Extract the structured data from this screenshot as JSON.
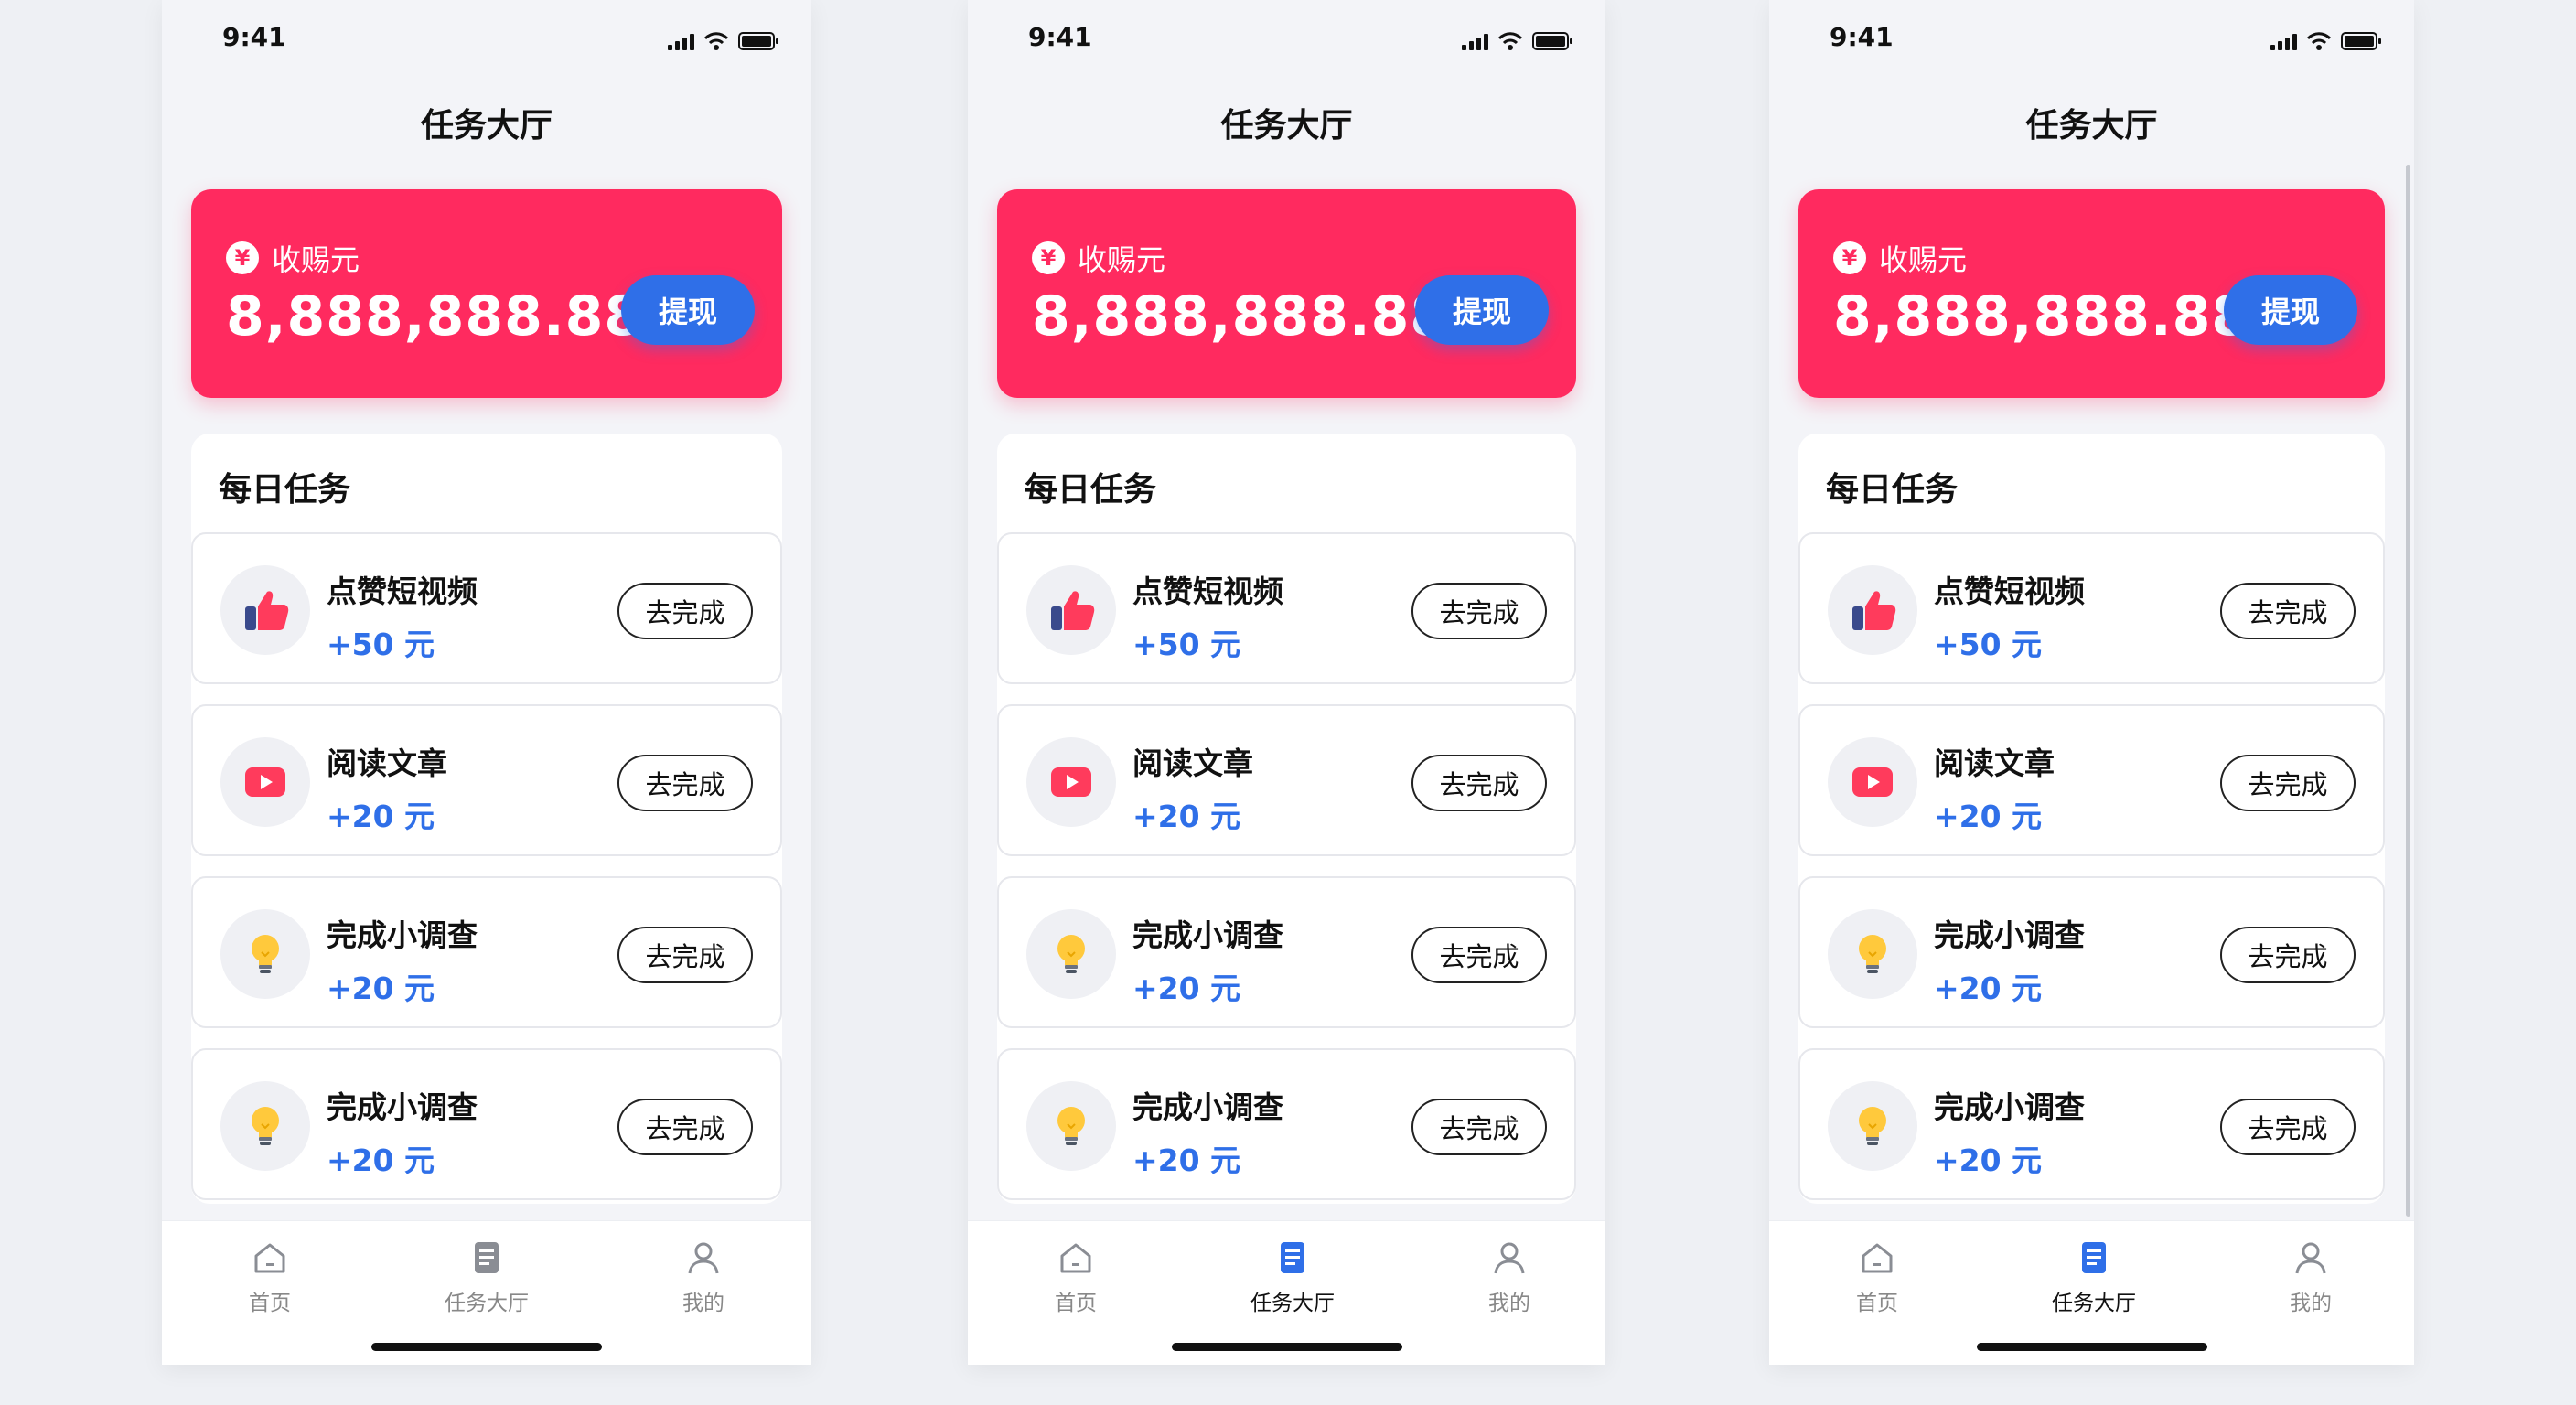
{
  "status": {
    "time": "9:41"
  },
  "nav": {
    "title": "任务大厅"
  },
  "balance": {
    "label": "收赐元",
    "coin_symbol": "¥",
    "amount": "8,888,888.88",
    "unit": "元",
    "withdraw": "提现"
  },
  "daily": {
    "title": "每日任务",
    "items": [
      {
        "name": "点赞短视频",
        "reward": "+50 元",
        "action": "去完成",
        "icon": "thumbs-up-icon"
      },
      {
        "name": "阅读文章",
        "reward": "+20 元",
        "action": "去完成",
        "icon": "play-icon"
      },
      {
        "name": "完成小调查",
        "reward": "+20 元",
        "action": "去完成",
        "icon": "lightbulb-icon"
      },
      {
        "name": "完成小调查",
        "reward": "+20 元",
        "action": "去完成",
        "icon": "lightbulb-icon"
      }
    ]
  },
  "tabs": [
    {
      "label": "首页",
      "icon": "home-icon"
    },
    {
      "label": "任务大厅",
      "icon": "task-list-icon"
    },
    {
      "label": "我的",
      "icon": "user-icon"
    }
  ],
  "active_tab_per_screen": [
    "none",
    "任务大厅",
    "任务大厅"
  ],
  "colors": {
    "accent": "#ff2a5f",
    "primary": "#2f6fe8"
  }
}
